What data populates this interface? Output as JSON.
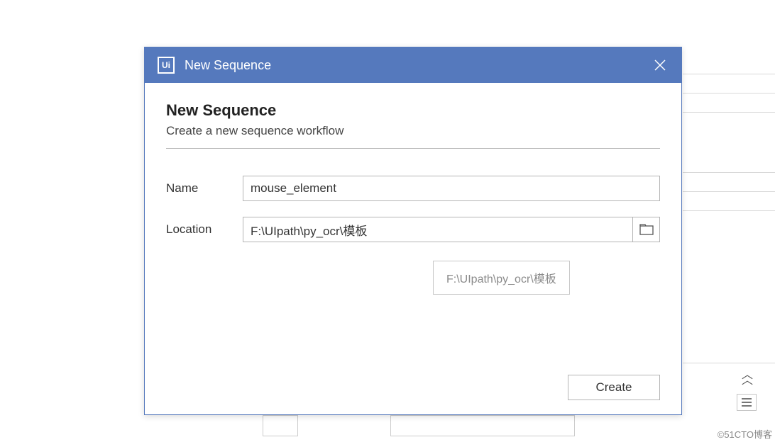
{
  "titlebar": {
    "icon_text": "Ui",
    "title": "New Sequence"
  },
  "dialog": {
    "heading": "New Sequence",
    "subheading": "Create a new sequence workflow",
    "name_label": "Name",
    "name_value": "mouse_element",
    "location_label": "Location",
    "location_value": "F:\\UIpath\\py_ocr\\模板",
    "tooltip": "F:\\UIpath\\py_ocr\\模板",
    "create_label": "Create"
  },
  "watermark": "©51CTO博客"
}
